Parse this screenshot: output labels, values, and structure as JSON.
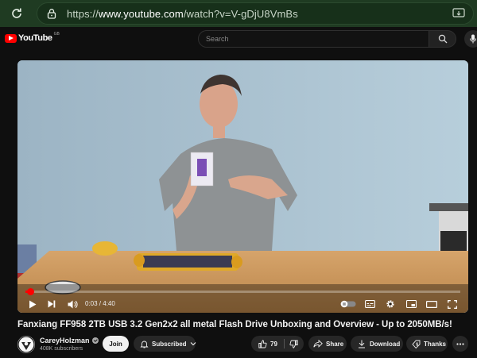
{
  "browser": {
    "url_prefix": "https://",
    "url_main": "www.youtube.com",
    "url_path": "/watch?v=V-gDjU8VmBs"
  },
  "header": {
    "logo_text": "YouTube",
    "region": "GB",
    "search_placeholder": "Search"
  },
  "player": {
    "time": "0:03 / 4:40",
    "progress_fraction": 0.011
  },
  "video": {
    "title": "Fanxiang FF958 2TB USB 3.2 Gen2x2 all metal Flash Drive Unboxing and Overview - Up to 2050MB/s!"
  },
  "channel": {
    "name": "CareyHolzman",
    "subscribers": "408K subscribers",
    "join_label": "Join",
    "subscribed_label": "Subscribed"
  },
  "actions": {
    "likes": "79",
    "share": "Share",
    "download": "Download",
    "thanks": "Thanks"
  },
  "colors": {
    "accent": "#ff0000",
    "background": "#0f0f0f",
    "browser_bar": "#1f3b22"
  }
}
